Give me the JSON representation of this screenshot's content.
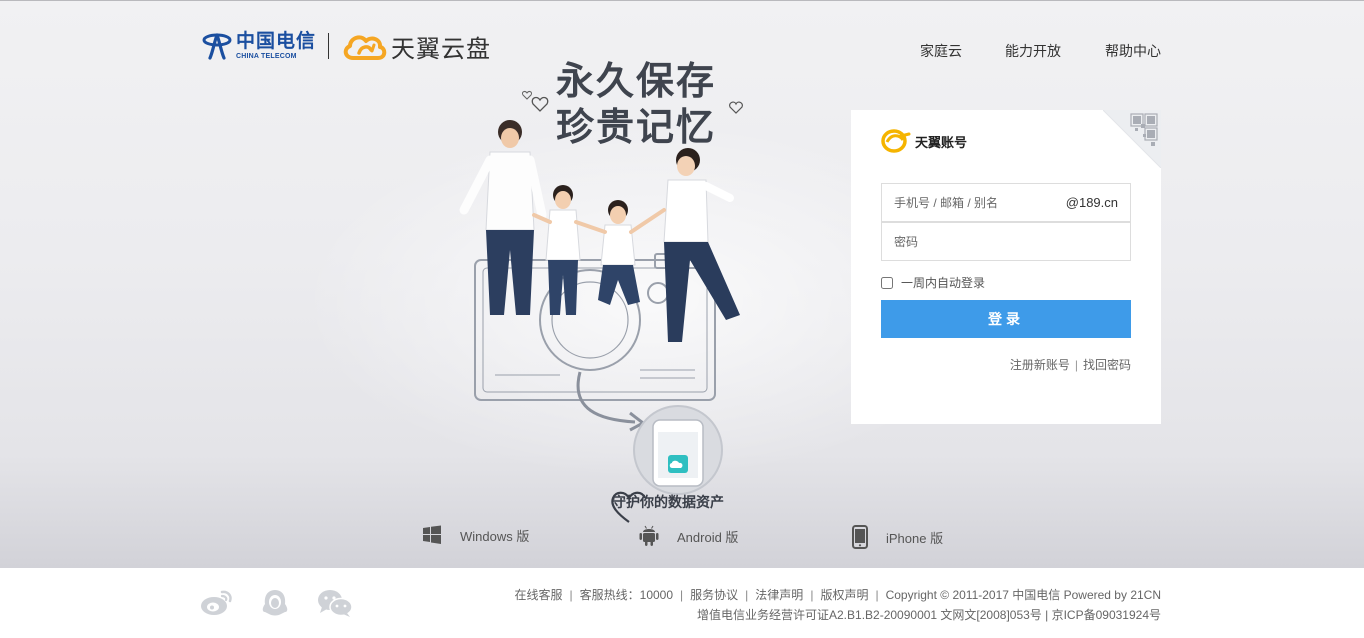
{
  "header": {
    "telecom_logo_cn": "中国电信",
    "telecom_logo_en": "CHINA TELECOM",
    "product_name": "天翼云盘",
    "nav": [
      "家庭云",
      "能力开放",
      "帮助中心"
    ]
  },
  "hero": {
    "slogan_line1": "永久保存",
    "slogan_line2": "珍贵记忆",
    "protect_caption": "守护你的数据资产"
  },
  "downloads": [
    {
      "label": "Windows 版",
      "icon": "windows-icon"
    },
    {
      "label": "Android 版",
      "icon": "android-icon"
    },
    {
      "label": "iPhone 版",
      "icon": "iphone-icon"
    }
  ],
  "login": {
    "brand": "天翼账号",
    "account_placeholder": "手机号 / 邮箱 / 别名",
    "account_suffix": "@189.cn",
    "password_placeholder": "密码",
    "remember_label": "一周内自动登录",
    "remember_checked": false,
    "submit_label": "登录",
    "register_link": "注册新账号",
    "forgot_link": "找回密码",
    "qr_icon": "qr-code-icon"
  },
  "footer": {
    "links": [
      "在线客服",
      "客服热线：10000",
      "服务协议",
      "法律声明",
      "版权声明"
    ],
    "copyright": "Copyright © 2011-2017 中国电信 Powered by 21CN",
    "license": "增值电信业务经营许可证A2.B1.B2-20090001 文网文[2008]053号 | 京ICP备09031924号",
    "social_icons": [
      "weibo-icon",
      "qq-icon",
      "wechat-icon"
    ]
  },
  "colors": {
    "accent": "#3e9be9",
    "telecom_blue": "#1b4fa0",
    "cloud_orange": "#f5a623"
  }
}
